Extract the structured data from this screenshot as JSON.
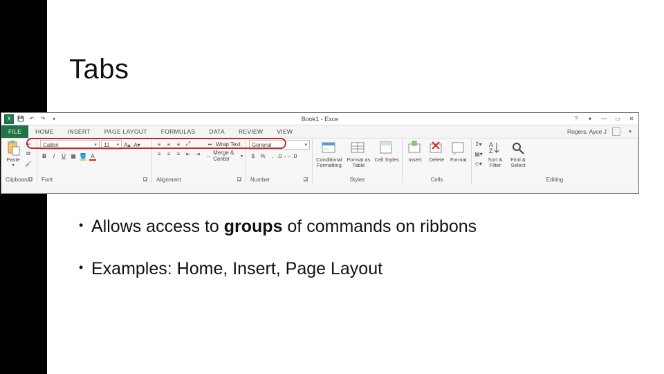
{
  "slide": {
    "title": "Tabs",
    "bullets": {
      "b1a": "Allows access to ",
      "b1bold": "groups",
      "b1c": " of commands on ribbons",
      "b2": "Examples: Home, Insert, Page Layout"
    }
  },
  "excel": {
    "apptitle": "Book1 - Exce",
    "user": "Rogers, Ayce J",
    "qat": {
      "help": "?",
      "ribbonopt": "▾",
      "min": "—",
      "max": "▭",
      "close": "✕"
    },
    "tabs": {
      "file": "FILE",
      "home": "HOME",
      "insert": "INSERT",
      "pagelayout": "PAGE LAYOUT",
      "formulas": "FORMULAS",
      "data": "DATA",
      "review": "REVIEW",
      "view": "VIEW"
    },
    "font": {
      "name": "Calibri",
      "size": "11"
    },
    "wrap": "Wrap Text",
    "merge": "Merge & Center",
    "numfmt": "General",
    "groups": {
      "clipboard": "Clipboard",
      "font": "Font",
      "alignment": "Alignment",
      "number": "Number",
      "styles": "Styles",
      "cells": "Cells",
      "editing": "Editing"
    },
    "btn": {
      "paste": "Paste",
      "condfmt": "Conditional Formatting",
      "fmttable": "Format as Table",
      "cellstyles": "Cell Styles",
      "insert": "Insert",
      "delete": "Delete",
      "format": "Format",
      "sort": "Sort & Filter",
      "find": "Find & Select"
    }
  }
}
